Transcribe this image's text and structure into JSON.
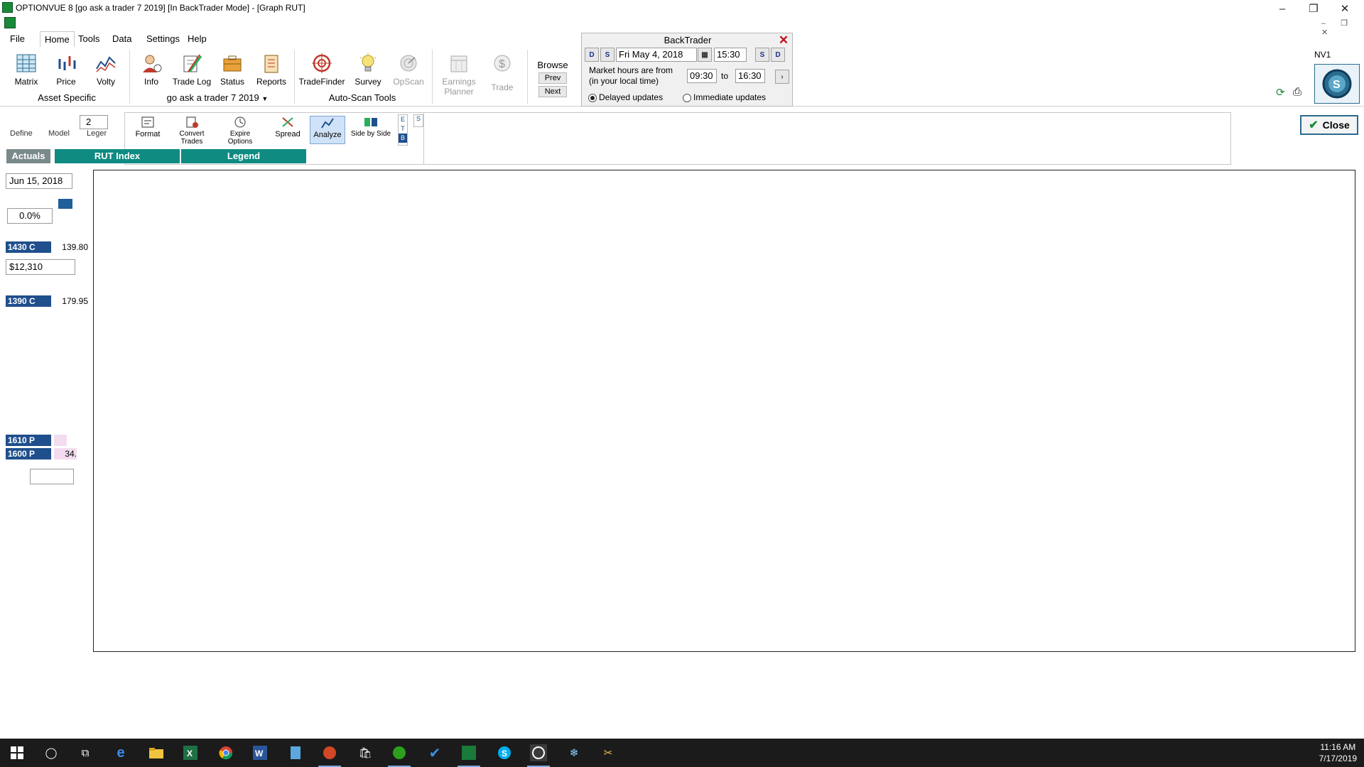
{
  "window": {
    "title": "OPTIONVUE 8  [go ask a trader 7 2019]  [In BackTrader Mode] - [Graph RUT]",
    "controls": {
      "minimize": "–",
      "maximize": "❐",
      "close": "✕"
    }
  },
  "menu": [
    "File",
    "Home",
    "Tools",
    "Data",
    "Settings",
    "Help"
  ],
  "ribbon": {
    "asset_specific": {
      "buttons": [
        "Matrix",
        "Price",
        "Volty"
      ],
      "label": "Asset Specific"
    },
    "portfolio": {
      "buttons": [
        "Info",
        "Trade Log",
        "Status",
        "Reports"
      ],
      "dropdown_label": "go ask a trader 7 2019"
    },
    "autoscan": {
      "buttons": [
        "TradeFinder",
        "Survey",
        "OpScan"
      ],
      "label": "Auto-Scan Tools"
    },
    "earnings_planner": {
      "line1": "Earnings",
      "line2": "Planner"
    },
    "trade": "Trade",
    "browse": {
      "label": "Browse",
      "prev": "Prev",
      "next": "Next"
    }
  },
  "backtrader": {
    "title": "BackTrader",
    "date": "Fri May 4, 2018",
    "time": "15:30",
    "market_hours_line1": "Market hours are from",
    "market_hours_line2": "(in your local time)",
    "from": "09:30",
    "to_label": "to",
    "to": "16:30",
    "delayed": "Delayed updates",
    "immediate": "Immediate updates",
    "nav": {
      "d_back": "D",
      "s_back": "S",
      "s_fwd": "S",
      "d_fwd": "D"
    }
  },
  "right_panel": {
    "nv": "NV1",
    "close": "Close"
  },
  "sub_toolbar": {
    "leg_count": "2",
    "left_tabs": [
      "Define",
      "Model",
      "Leger"
    ],
    "buttons": [
      "Format",
      "Convert Trades",
      "Expire Options",
      "Spread",
      "Analyze",
      "Side by Side"
    ],
    "mini": [
      "E",
      "T",
      "B",
      "S"
    ]
  },
  "tabs": {
    "actuals": "Actuals",
    "rut_index": "RUT Index",
    "legend": "Legend"
  },
  "left_pane": {
    "date": "Jun 15, 2018",
    "percent": "0.0%",
    "pnl": "$12,310",
    "legs": [
      {
        "name": "1430 C",
        "value": "139.80"
      },
      {
        "name": "1390 C",
        "value": "179.95"
      },
      {
        "name": "1610 P",
        "value": ""
      },
      {
        "name": "1600 P",
        "value": "34."
      }
    ]
  },
  "taskbar": {
    "time": "11:16 AM",
    "date": "7/17/2019"
  },
  "colors": {
    "teal_tab": "#0f8b82",
    "leg_blue": "#1f4f8c",
    "taskbar": "#1b1b1b"
  }
}
